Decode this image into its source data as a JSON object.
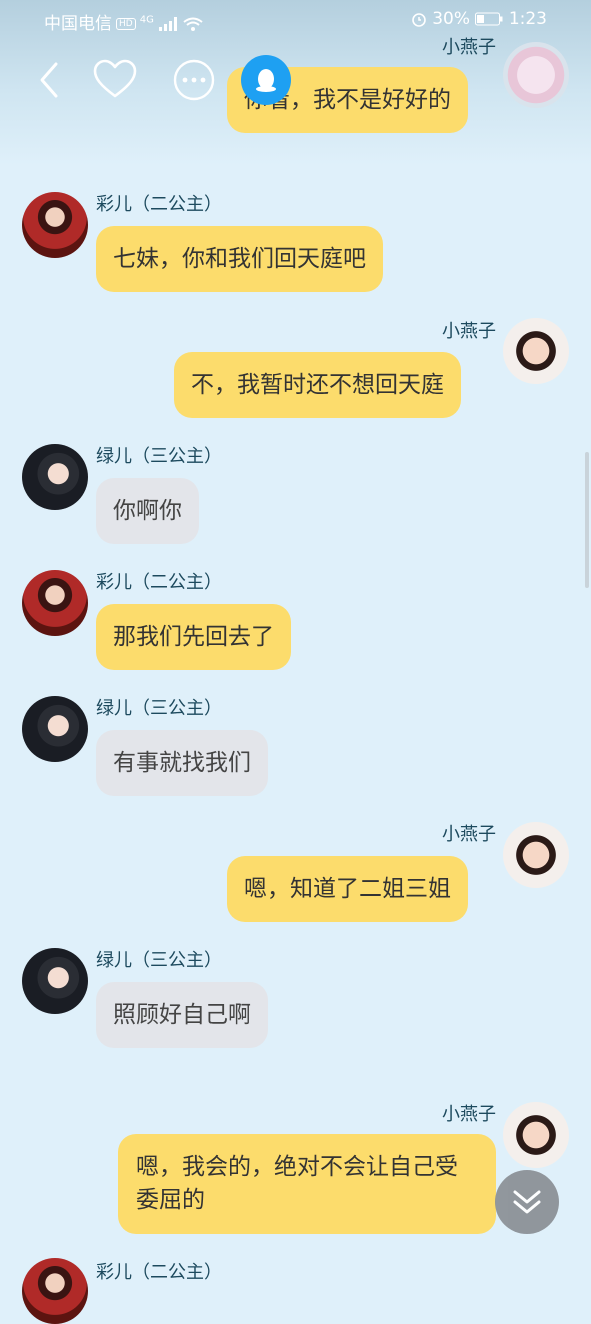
{
  "status_bar": {
    "carrier": "中国电信",
    "hd": "HD",
    "network": "4G",
    "battery": "30%",
    "time": "1:23"
  },
  "nav": {
    "back_icon": "chevron-left-icon",
    "favorite_icon": "heart-icon",
    "more_icon": "more-dots-icon",
    "qq_icon": "qq-penguin-icon"
  },
  "messages": [
    {
      "sender": "小燕子",
      "side": "right",
      "text": "你看，我不是好好的",
      "style": "yellow"
    },
    {
      "sender": "彩儿（二公主）",
      "side": "left",
      "text": "七妹，你和我们回天庭吧",
      "style": "yellow"
    },
    {
      "sender": "小燕子",
      "side": "right",
      "text": "不，我暂时还不想回天庭",
      "style": "yellow"
    },
    {
      "sender": "绿儿（三公主）",
      "side": "left",
      "text": "你啊你",
      "style": "gray"
    },
    {
      "sender": "彩儿（二公主）",
      "side": "left",
      "text": "那我们先回去了",
      "style": "yellow"
    },
    {
      "sender": "绿儿（三公主）",
      "side": "left",
      "text": "有事就找我们",
      "style": "gray"
    },
    {
      "sender": "小燕子",
      "side": "right",
      "text": "嗯，知道了二姐三姐",
      "style": "yellow"
    },
    {
      "sender": "绿儿（三公主）",
      "side": "left",
      "text": "照顾好自己啊",
      "style": "gray"
    },
    {
      "sender": "小燕子",
      "side": "right",
      "text": "嗯，我会的，绝对不会让自己受委屈的",
      "style": "yellow"
    },
    {
      "sender": "彩儿（二公主）",
      "side": "left",
      "text": "",
      "style": "yellow"
    }
  ],
  "scroll_down_icon": "double-chevron-down-icon",
  "colors": {
    "background": "#dff0fa",
    "yellow_bubble": "#fcdc6c",
    "gray_bubble": "#e3e5ea",
    "name_text": "#1d4a5e",
    "qq_blue": "#1ea0f2"
  }
}
